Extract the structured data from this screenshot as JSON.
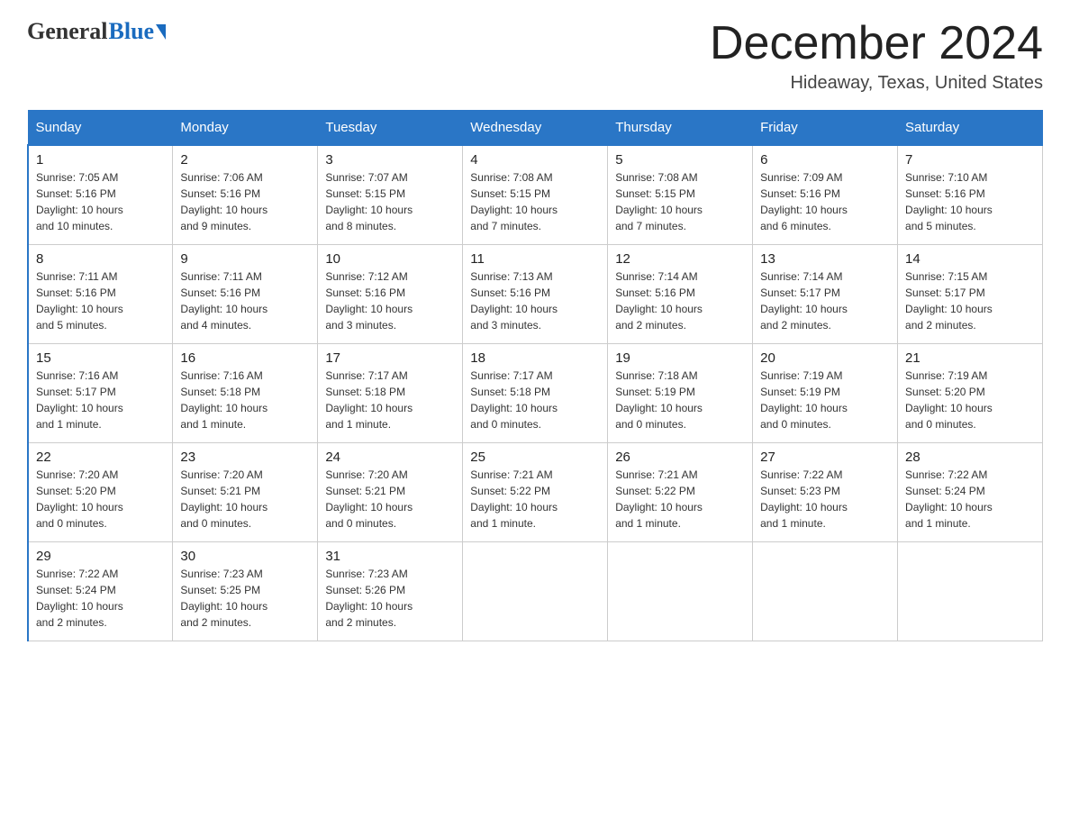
{
  "header": {
    "logo_general": "General",
    "logo_blue": "Blue",
    "title": "December 2024",
    "location": "Hideaway, Texas, United States"
  },
  "days_of_week": [
    "Sunday",
    "Monday",
    "Tuesday",
    "Wednesday",
    "Thursday",
    "Friday",
    "Saturday"
  ],
  "weeks": [
    [
      {
        "day": "1",
        "sunrise": "7:05 AM",
        "sunset": "5:16 PM",
        "daylight": "10 hours and 10 minutes."
      },
      {
        "day": "2",
        "sunrise": "7:06 AM",
        "sunset": "5:16 PM",
        "daylight": "10 hours and 9 minutes."
      },
      {
        "day": "3",
        "sunrise": "7:07 AM",
        "sunset": "5:15 PM",
        "daylight": "10 hours and 8 minutes."
      },
      {
        "day": "4",
        "sunrise": "7:08 AM",
        "sunset": "5:15 PM",
        "daylight": "10 hours and 7 minutes."
      },
      {
        "day": "5",
        "sunrise": "7:08 AM",
        "sunset": "5:15 PM",
        "daylight": "10 hours and 7 minutes."
      },
      {
        "day": "6",
        "sunrise": "7:09 AM",
        "sunset": "5:16 PM",
        "daylight": "10 hours and 6 minutes."
      },
      {
        "day": "7",
        "sunrise": "7:10 AM",
        "sunset": "5:16 PM",
        "daylight": "10 hours and 5 minutes."
      }
    ],
    [
      {
        "day": "8",
        "sunrise": "7:11 AM",
        "sunset": "5:16 PM",
        "daylight": "10 hours and 5 minutes."
      },
      {
        "day": "9",
        "sunrise": "7:11 AM",
        "sunset": "5:16 PM",
        "daylight": "10 hours and 4 minutes."
      },
      {
        "day": "10",
        "sunrise": "7:12 AM",
        "sunset": "5:16 PM",
        "daylight": "10 hours and 3 minutes."
      },
      {
        "day": "11",
        "sunrise": "7:13 AM",
        "sunset": "5:16 PM",
        "daylight": "10 hours and 3 minutes."
      },
      {
        "day": "12",
        "sunrise": "7:14 AM",
        "sunset": "5:16 PM",
        "daylight": "10 hours and 2 minutes."
      },
      {
        "day": "13",
        "sunrise": "7:14 AM",
        "sunset": "5:17 PM",
        "daylight": "10 hours and 2 minutes."
      },
      {
        "day": "14",
        "sunrise": "7:15 AM",
        "sunset": "5:17 PM",
        "daylight": "10 hours and 2 minutes."
      }
    ],
    [
      {
        "day": "15",
        "sunrise": "7:16 AM",
        "sunset": "5:17 PM",
        "daylight": "10 hours and 1 minute."
      },
      {
        "day": "16",
        "sunrise": "7:16 AM",
        "sunset": "5:18 PM",
        "daylight": "10 hours and 1 minute."
      },
      {
        "day": "17",
        "sunrise": "7:17 AM",
        "sunset": "5:18 PM",
        "daylight": "10 hours and 1 minute."
      },
      {
        "day": "18",
        "sunrise": "7:17 AM",
        "sunset": "5:18 PM",
        "daylight": "10 hours and 0 minutes."
      },
      {
        "day": "19",
        "sunrise": "7:18 AM",
        "sunset": "5:19 PM",
        "daylight": "10 hours and 0 minutes."
      },
      {
        "day": "20",
        "sunrise": "7:19 AM",
        "sunset": "5:19 PM",
        "daylight": "10 hours and 0 minutes."
      },
      {
        "day": "21",
        "sunrise": "7:19 AM",
        "sunset": "5:20 PM",
        "daylight": "10 hours and 0 minutes."
      }
    ],
    [
      {
        "day": "22",
        "sunrise": "7:20 AM",
        "sunset": "5:20 PM",
        "daylight": "10 hours and 0 minutes."
      },
      {
        "day": "23",
        "sunrise": "7:20 AM",
        "sunset": "5:21 PM",
        "daylight": "10 hours and 0 minutes."
      },
      {
        "day": "24",
        "sunrise": "7:20 AM",
        "sunset": "5:21 PM",
        "daylight": "10 hours and 0 minutes."
      },
      {
        "day": "25",
        "sunrise": "7:21 AM",
        "sunset": "5:22 PM",
        "daylight": "10 hours and 1 minute."
      },
      {
        "day": "26",
        "sunrise": "7:21 AM",
        "sunset": "5:22 PM",
        "daylight": "10 hours and 1 minute."
      },
      {
        "day": "27",
        "sunrise": "7:22 AM",
        "sunset": "5:23 PM",
        "daylight": "10 hours and 1 minute."
      },
      {
        "day": "28",
        "sunrise": "7:22 AM",
        "sunset": "5:24 PM",
        "daylight": "10 hours and 1 minute."
      }
    ],
    [
      {
        "day": "29",
        "sunrise": "7:22 AM",
        "sunset": "5:24 PM",
        "daylight": "10 hours and 2 minutes."
      },
      {
        "day": "30",
        "sunrise": "7:23 AM",
        "sunset": "5:25 PM",
        "daylight": "10 hours and 2 minutes."
      },
      {
        "day": "31",
        "sunrise": "7:23 AM",
        "sunset": "5:26 PM",
        "daylight": "10 hours and 2 minutes."
      },
      null,
      null,
      null,
      null
    ]
  ],
  "labels": {
    "sunrise": "Sunrise:",
    "sunset": "Sunset:",
    "daylight": "Daylight:"
  }
}
